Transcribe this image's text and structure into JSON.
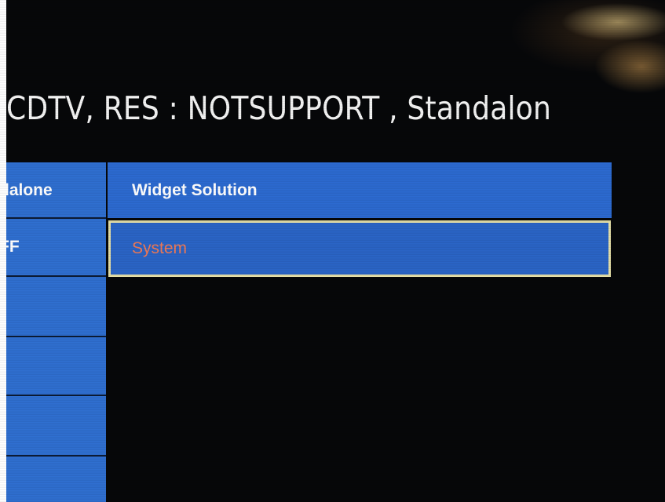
{
  "header": {
    "title": "CDTV, RES : NOTSUPPORT , Standalon"
  },
  "left_column": {
    "cells": [
      {
        "label": "dalone"
      },
      {
        "label": "FF"
      },
      {
        "label": ""
      },
      {
        "label": ""
      },
      {
        "label": ""
      },
      {
        "label": ""
      }
    ]
  },
  "right_column": {
    "header_label": "Widget Solution",
    "items": [
      {
        "label": "System",
        "selected": true
      }
    ]
  },
  "colors": {
    "panel_blue": "#2f6fd0",
    "selection_border": "#e6e0a8",
    "selected_text": "#f07a57",
    "background": "#060709"
  }
}
